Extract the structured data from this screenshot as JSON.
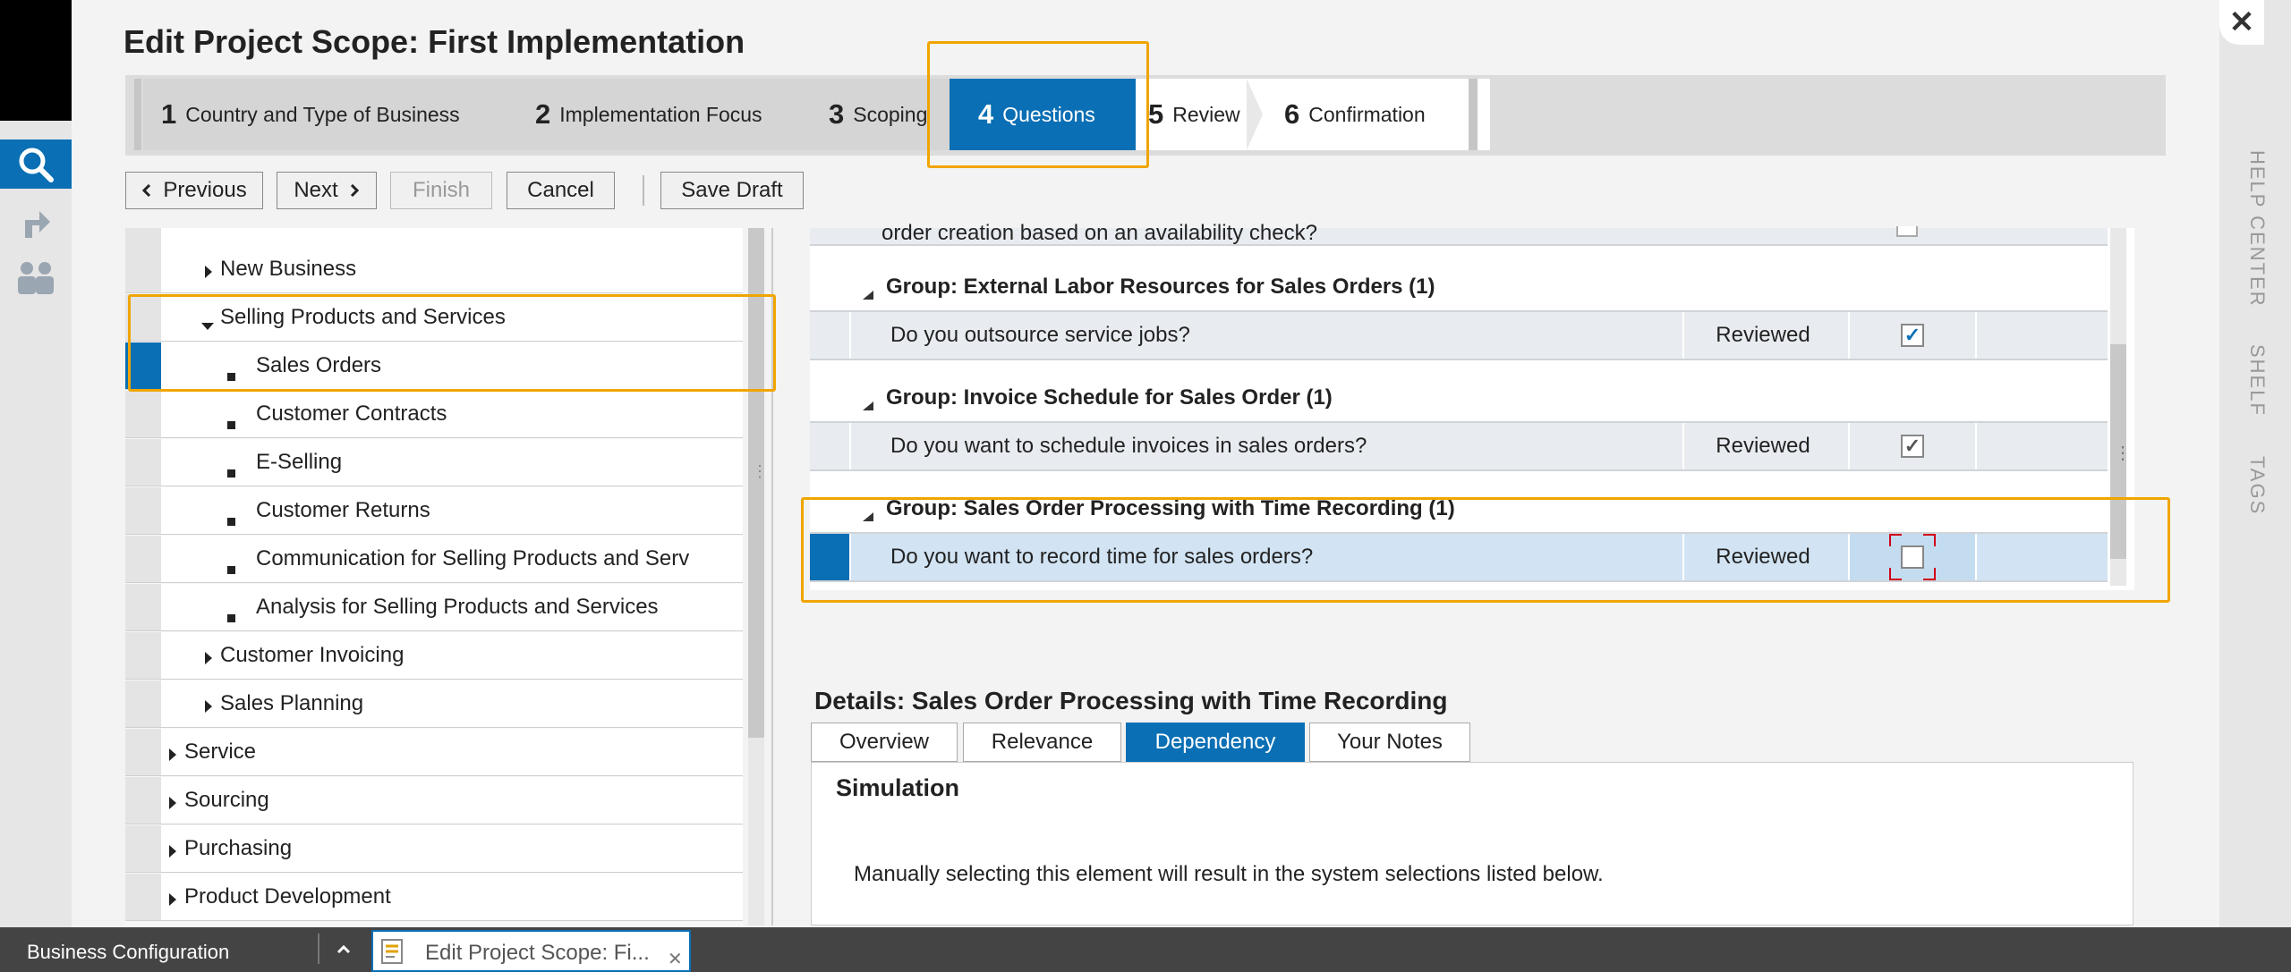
{
  "title": "Edit Project Scope: First Implementation",
  "steps": [
    {
      "num": "1",
      "label": "Country and Type of Business"
    },
    {
      "num": "2",
      "label": "Implementation Focus"
    },
    {
      "num": "3",
      "label": "Scoping"
    },
    {
      "num": "4",
      "label": "Questions"
    },
    {
      "num": "5",
      "label": "Review"
    },
    {
      "num": "6",
      "label": "Confirmation"
    }
  ],
  "toolbar": {
    "previous": "Previous",
    "next": "Next",
    "finish": "Finish",
    "cancel": "Cancel",
    "save_draft": "Save Draft"
  },
  "tree": [
    {
      "label": "New Business",
      "marker": "right"
    },
    {
      "label": "Selling Products and Services",
      "marker": "down"
    },
    {
      "label": "Sales Orders",
      "marker": "bullet"
    },
    {
      "label": "Customer Contracts",
      "marker": "bullet"
    },
    {
      "label": "E-Selling",
      "marker": "bullet"
    },
    {
      "label": "Customer Returns",
      "marker": "bullet"
    },
    {
      "label": "Communication for Selling Products and Serv",
      "marker": "bullet"
    },
    {
      "label": "Analysis for Selling Products and Services",
      "marker": "bullet"
    },
    {
      "label": "Customer Invoicing",
      "marker": "right"
    },
    {
      "label": "Sales Planning",
      "marker": "right"
    },
    {
      "label": "Service",
      "marker": "right"
    },
    {
      "label": "Sourcing",
      "marker": "right"
    },
    {
      "label": "Purchasing",
      "marker": "right"
    },
    {
      "label": "Product Development",
      "marker": "right"
    }
  ],
  "questions": {
    "partial_top": "order creation based on an availability check?",
    "groups": [
      {
        "header": "Group: External Labor Resources for Sales Orders (1)",
        "question": "Do you outsource service jobs?",
        "status": "Reviewed",
        "checked": true
      },
      {
        "header": "Group: Invoice Schedule for Sales Order (1)",
        "question": "Do you want to schedule invoices in sales orders?",
        "status": "Reviewed",
        "checked": true
      },
      {
        "header": "Group: Sales Order Processing with Time Recording (1)",
        "question": "Do you want to record time for sales orders?",
        "status": "Reviewed",
        "checked": false
      }
    ]
  },
  "details": {
    "title": "Details: Sales Order Processing with Time Recording",
    "tabs": [
      "Overview",
      "Relevance",
      "Dependency",
      "Your Notes"
    ],
    "simulation_title": "Simulation",
    "simulation_text": "Manually selecting this element will result in the system selections listed below."
  },
  "right_rail": [
    "HELP CENTER",
    "SHELF",
    "TAGS"
  ],
  "taskbar": {
    "app": "Business Configuration",
    "window": "Edit Project Scope: Fi..."
  },
  "colors": {
    "accent": "#0a6fb4",
    "highlight": "#f0a500",
    "topbar_green": "#a6e01b"
  },
  "icons": [
    "search-icon",
    "share-icon",
    "users-icon",
    "close-icon",
    "checkmark-icon",
    "document-icon"
  ]
}
